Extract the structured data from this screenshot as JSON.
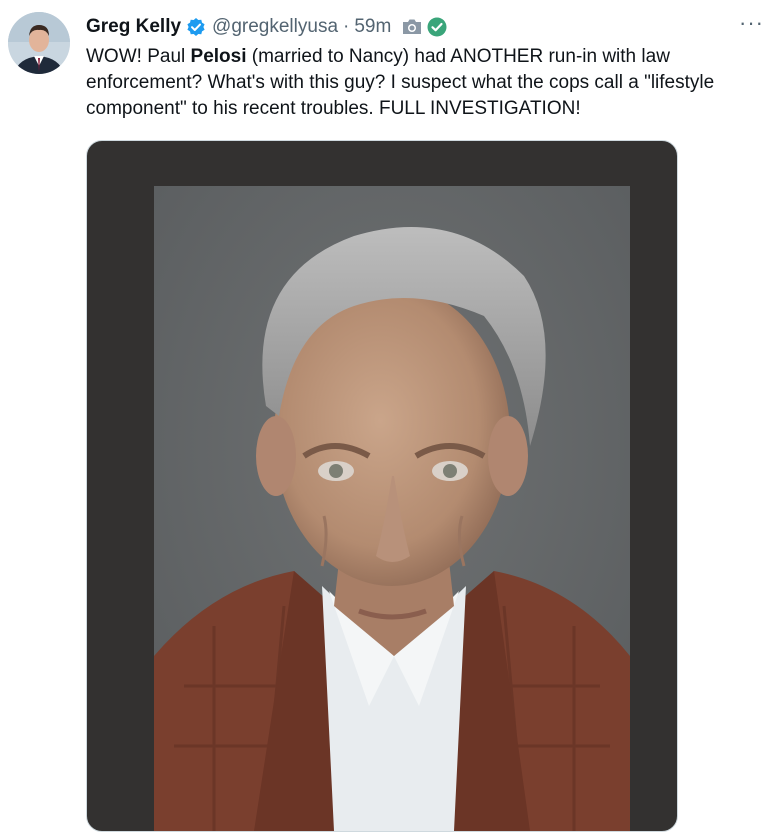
{
  "tweet": {
    "author_name": "Greg Kelly",
    "handle": "@gregkellyusa",
    "separator": "·",
    "time": "59m",
    "more_label": "···",
    "text_parts": {
      "p1": "WOW! Paul ",
      "bold": "Pelosi",
      "p2": " (married to Nancy) had ANOTHER run-in with law enforcement? What's with this guy? I suspect what the cops call a \"lifestyle component\" to his recent troubles.  FULL INVESTIGATION!"
    }
  },
  "icons": {
    "verified": "verified-badge-icon",
    "camera": "camera-icon",
    "check": "checkmark-circle-icon",
    "more": "more-options-icon"
  },
  "colors": {
    "verified_blue": "#1d9bf0",
    "check_green": "#3aa57a",
    "secondary_text": "#536471",
    "media_frame": "#333130"
  }
}
